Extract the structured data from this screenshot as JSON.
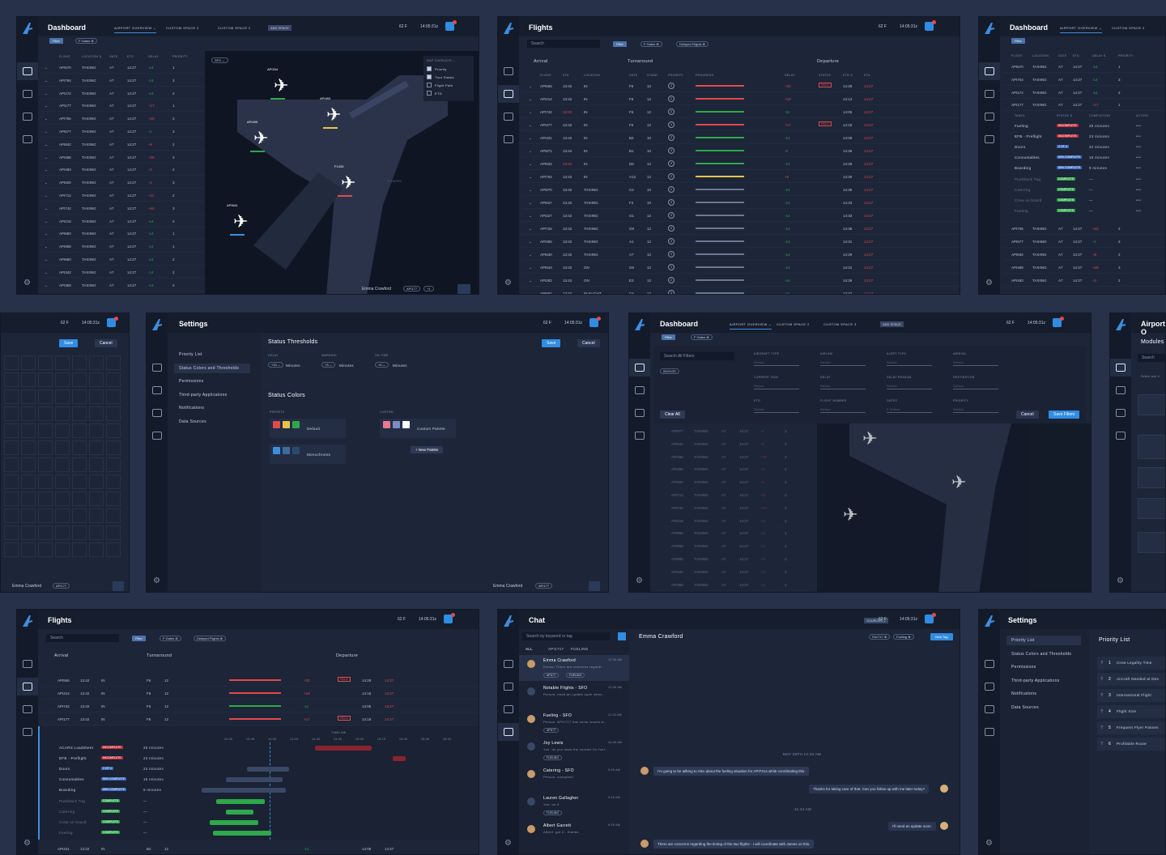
{
  "weather": "62 F",
  "clock": "14:05:31z",
  "user": "Emma Crawford",
  "flight_tag": "API177",
  "flight_tag_count": "+1",
  "colors": {
    "accent": "#3d8ee0",
    "red": "#e24a4a",
    "green": "#2ea84a",
    "yellow": "#e8c34a",
    "panel": "#1d2538"
  },
  "dash1": {
    "title": "Dashboard",
    "tabs": [
      "AIRPORT OVERVIEW ⌄",
      "CUSTOM SPACE 2",
      "CUSTOM SPACE 2"
    ],
    "add_space": "ADD SPACE",
    "filter": "Filter",
    "gates_chip": "F Gates ⊗",
    "cols": [
      "FLIGHT",
      "LOCATION ⇅",
      "GATE",
      "ETD",
      "DELAY",
      "PRIORITY"
    ],
    "rows": [
      [
        "API570",
        "TAXIING",
        "A7",
        "14:27",
        "-14",
        "1"
      ],
      [
        "API794",
        "TAXIING",
        "A7",
        "14:27",
        "-14",
        "3"
      ],
      [
        "API172",
        "TAXIING",
        "A7",
        "14:27",
        "-14",
        "2"
      ],
      [
        "API177",
        "TAXIING",
        "A7",
        "14:27",
        "+17",
        "1"
      ],
      [
        "API756",
        "TAXIING",
        "A7",
        "14:27",
        "+20",
        "2"
      ],
      [
        "API577",
        "TAXIING",
        "A7",
        "14:27",
        "-4",
        "3"
      ],
      [
        "API842",
        "TAXIING",
        "A7",
        "14:27",
        "+5",
        "2"
      ],
      [
        "API468",
        "TAXIING",
        "A7",
        "14:27",
        "+28",
        "3"
      ],
      [
        "API493",
        "TAXIING",
        "A7",
        "14:27",
        "+2",
        "2"
      ],
      [
        "API820",
        "TAXIING",
        "A7",
        "14:27",
        "+1",
        "3"
      ],
      [
        "API712",
        "TAXIING",
        "A7",
        "14:27",
        "+11",
        "2"
      ],
      [
        "API742",
        "TAXIING",
        "A7",
        "14:27",
        "+44",
        "3"
      ],
      [
        "API218",
        "TAXIING",
        "A7",
        "14:27",
        "-14",
        "2"
      ],
      [
        "API850",
        "TAXIING",
        "A7",
        "14:27",
        "-14",
        "1"
      ],
      [
        "API958",
        "TAXIING",
        "A7",
        "14:27",
        "-14",
        "1"
      ],
      [
        "API860",
        "TAXIING",
        "A7",
        "14:27",
        "-14",
        "2"
      ],
      [
        "API342",
        "TAXIING",
        "A7",
        "14:27",
        "-14",
        "2"
      ],
      [
        "API369",
        "TAXIING",
        "A7",
        "14:27",
        "-14",
        "2"
      ]
    ],
    "map_select": "SFO ⌄",
    "overlays_title": "MAP OVERLAYS ⌄",
    "overlays": [
      "Priority",
      "Turn Status",
      "Flight Path",
      "ETD"
    ],
    "planes": [
      "API204",
      "API493",
      "API499",
      "F1433",
      "API844"
    ],
    "gates_label": "F GATES"
  },
  "flights1": {
    "title": "Flights",
    "search": "Search",
    "filter": "Filter",
    "chip1": "F Gates ⊗",
    "chip2": "Delayed Flights ⊗",
    "sections": [
      "Arrival",
      "Turnaround",
      "Departure"
    ],
    "cols": [
      "FLIGHT",
      "ETA",
      "LOCATION",
      "GATE",
      "STAND",
      "PRIORITY",
      "PROGRESS",
      "DELAY",
      "STATUS",
      "ETD ⇅",
      "ETA"
    ],
    "rows": [
      [
        "API565",
        "13:42",
        "IN",
        "F6",
        "12",
        "2",
        "+32",
        "HOLD",
        "14:28",
        "14:27"
      ],
      [
        "API214",
        "13:42",
        "IN",
        "F6",
        "12",
        "2",
        "+19",
        "",
        "14:13",
        "14:27"
      ],
      [
        "API742",
        "13:42",
        "IN",
        "F6",
        "12",
        "2",
        "-11",
        "",
        "14:05",
        "14:27"
      ],
      [
        "API377",
        "13:42",
        "IN",
        "F6",
        "12",
        "1",
        "+17",
        "HOLD",
        "14:18",
        "14:27"
      ],
      [
        "API431",
        "13:42",
        "IN",
        "B2",
        "10",
        "2",
        "-14",
        "",
        "14:08",
        "14:27"
      ],
      [
        "API871",
        "13:42",
        "IN",
        "B1",
        "10",
        "2",
        "-5",
        "",
        "14:36",
        "14:27"
      ],
      [
        "API832",
        "13:42",
        "IN",
        "D6",
        "12",
        "2",
        "-14",
        "",
        "14:29",
        "14:27"
      ],
      [
        "API764",
        "13:42",
        "IN",
        "A13",
        "12",
        "2",
        "+6",
        "",
        "14:30",
        "14:27"
      ],
      [
        "API870",
        "13:42",
        "TAXIING",
        "C2",
        "10",
        "1",
        "-14",
        "",
        "14:38",
        "14:27"
      ],
      [
        "API637",
        "13:42",
        "TAXIING",
        "F3",
        "10",
        "2",
        "-14",
        "",
        "14:43",
        "14:27"
      ],
      [
        "API227",
        "13:42",
        "TAXIING",
        "G1",
        "12",
        "2",
        "-14",
        "",
        "14:33",
        "14:27"
      ],
      [
        "API726",
        "13:42",
        "TAXIING",
        "G9",
        "12",
        "2",
        "-14",
        "",
        "14:36",
        "14:27"
      ],
      [
        "API355",
        "13:42",
        "TAXIING",
        "A1",
        "12",
        "2",
        "-14",
        "",
        "14:31",
        "14:27"
      ],
      [
        "API630",
        "13:42",
        "TAXIING",
        "A7",
        "12",
        "1",
        "-14",
        "",
        "14:29",
        "14:27"
      ],
      [
        "API543",
        "13:42",
        "ON",
        "G6",
        "12",
        "1",
        "-14",
        "",
        "14:31",
        "14:27"
      ],
      [
        "API282",
        "13:42",
        "ON",
        "E3",
        "12",
        "2",
        "-14",
        "",
        "14:39",
        "14:27"
      ],
      [
        "API697",
        "13:42",
        "IN FLIGHT",
        "C6",
        "12",
        "2",
        "-14",
        "",
        "14:42",
        "14:27"
      ]
    ]
  },
  "dash2": {
    "title": "Dashboard",
    "tabs": [
      "AIRPORT OVERVIEW ⌄",
      "CUSTOM SPACE 2"
    ],
    "filter": "Filter",
    "cols": [
      "FLIGHT",
      "LOCATION",
      "GATE",
      "ETD",
      "DELAY ⇅",
      "PRIORITY"
    ],
    "rows_top": [
      [
        "API570",
        "TAXIING",
        "A7",
        "14:27",
        "-14",
        "1"
      ],
      [
        "API704",
        "TAXIING",
        "A7",
        "14:27",
        "-14",
        "3"
      ],
      [
        "API172",
        "TAXIING",
        "A7",
        "14:27",
        "-14",
        "2"
      ],
      [
        "API177",
        "TAXIING",
        "A7",
        "14:27",
        "+17",
        "1"
      ]
    ],
    "task_cols": [
      "TASKS",
      "STATUS ⇅",
      "COMPLETION",
      "ACTION"
    ],
    "tasks": [
      [
        "Fueling",
        "INCOMPLETE",
        "25 minutes"
      ],
      [
        "EFB - Preflight",
        "INCOMPLETE",
        "23 minutes"
      ],
      [
        "Doors",
        "2 OF 4",
        "22 minutes"
      ],
      [
        "Consumables",
        "50% COMPLETE",
        "15 minutes"
      ],
      [
        "Boarding",
        "65% COMPLETE",
        "9 minutes"
      ],
      [
        "Pushback Tug",
        "COMPLETE",
        "—"
      ],
      [
        "Catering",
        "COMPLETE",
        "—"
      ],
      [
        "Crew on board",
        "COMPLETE",
        "—"
      ],
      [
        "Fueling",
        "COMPLETE",
        "—"
      ]
    ],
    "rows_bottom": [
      [
        "API705",
        "TAXIING",
        "A7",
        "14:27",
        "+22",
        "2"
      ],
      [
        "API577",
        "TAXIING",
        "A7",
        "14:27",
        "-4",
        "3"
      ],
      [
        "API842",
        "TAXIING",
        "A7",
        "14:27",
        "+5",
        "2"
      ],
      [
        "API468",
        "TAXIING",
        "A7",
        "14:27",
        "+28",
        "3"
      ],
      [
        "API493",
        "TAXIING",
        "A7",
        "14:27",
        "+2",
        "2"
      ]
    ]
  },
  "edit": {
    "save": "Save",
    "cancel": "Cancel"
  },
  "settings1": {
    "title": "Settings",
    "save": "Save",
    "cancel": "Cancel",
    "menu": [
      "Priority List",
      "Status Colors and Thresholds",
      "Permissions",
      "Third-party Applications",
      "Notifications",
      "Data Sources"
    ],
    "thresholds_title": "Status Thresholds",
    "delay_label": "DELAY",
    "delay_val": "+15 ⌄",
    "warning_label": "WARNING",
    "warning_val": "+3 ⌄",
    "ontime_label": "ON TIME",
    "ontime_val": "+0 ⌄",
    "minutes": "Minutes",
    "colors_title": "Status Colors",
    "presets": "PRESETS",
    "custom": "CUSTOM",
    "default": "Default",
    "mono": "Monochrome",
    "custom_palette": "Custom Palette",
    "new_palette": "+ New Palette"
  },
  "dash3": {
    "title": "Dashboard",
    "tabs": [
      "AIRPORT OVERVIEW ⌄",
      "CUSTOM SPACE 2",
      "CUSTOM SPACE 3"
    ],
    "add_space": "ADD SPACE",
    "filter": "Filter",
    "chip": "F Gates ⊗",
    "search_filters": "Search All Filters",
    "date": "05/21/20",
    "filter_labels": [
      "AIRCRAFT TYPE",
      "AIRLINE",
      "ALERT TYPE",
      "ARRIVAL",
      "CURRENT TASK",
      "DELAY",
      "DELAY REASON",
      "DESTINATION",
      "ETD",
      "FLIGHT NUMBER",
      "GATES",
      "PRIORITY"
    ],
    "select": "Select",
    "gates_val": "F Gates",
    "clear": "Clear All",
    "cancel": "Cancel",
    "save": "Save Filters",
    "rows": [
      [
        "API577",
        "TAXIING",
        "A7",
        "14:27",
        "-4",
        "3"
      ],
      [
        "API842",
        "TAXIING",
        "A7",
        "14:27",
        "+5",
        "2"
      ],
      [
        "API468",
        "TAXIING",
        "A7",
        "14:27",
        "+28",
        "3"
      ],
      [
        "API493",
        "TAXIING",
        "A7",
        "14:27",
        "+2",
        "2"
      ],
      [
        "API820",
        "TAXIING",
        "A7",
        "14:27",
        "+1",
        "3"
      ],
      [
        "API712",
        "TAXIING",
        "A7",
        "14:27",
        "+11",
        "2"
      ],
      [
        "API742",
        "TAXIING",
        "A7",
        "14:27",
        "+44",
        "3"
      ],
      [
        "API218",
        "TAXIING",
        "A7",
        "14:27",
        "-14",
        "2"
      ],
      [
        "API850",
        "TAXIING",
        "A7",
        "14:27",
        "-14",
        "1"
      ],
      [
        "API958",
        "TAXIING",
        "A7",
        "14:27",
        "-14",
        "1"
      ],
      [
        "API860",
        "TAXIING",
        "A7",
        "14:27",
        "-14",
        "2"
      ],
      [
        "API342",
        "TAXIING",
        "A7",
        "14:27",
        "-14",
        "2"
      ],
      [
        "API369",
        "TAXIING",
        "A7",
        "14:27",
        "-14",
        "2"
      ]
    ]
  },
  "airport": {
    "title": "Airport O",
    "modules": "Modules",
    "search": "Search",
    "hint": "Select and d"
  },
  "flights2": {
    "title": "Flights",
    "search": "Search",
    "filter": "Filter",
    "chip1": "F Gates ⊗",
    "chip2": "Delayed Flights ⊗",
    "sections": [
      "Arrival",
      "Turnaround",
      "Departure"
    ],
    "rows": [
      [
        "API565",
        "13:42",
        "IN",
        "F6",
        "12",
        "+32",
        "HOLD",
        "14:28",
        "14:27"
      ],
      [
        "API214",
        "13:42",
        "IN",
        "F6",
        "12",
        "+19",
        "",
        "14:16",
        "14:27"
      ],
      [
        "API742",
        "13:42",
        "IN",
        "F6",
        "12",
        "-11",
        "",
        "14:05",
        "14:27"
      ],
      [
        "API177",
        "13:42",
        "IN",
        "F6",
        "12",
        "+17",
        "HOLD",
        "14:18",
        "14:27"
      ]
    ],
    "times": [
      "13:00",
      "13:45",
      "14:00",
      "14:15",
      "14:30",
      "14:45",
      "15:00",
      "15:15",
      "15:30",
      "15:45",
      "16:00"
    ],
    "tasks": [
      [
        "ACARS Loadsheet",
        "INCOMPLETE",
        "25 minutes"
      ],
      [
        "EFB - Preflight",
        "INCOMPLETE",
        "23 minutes"
      ],
      [
        "Doors",
        "2 OF 4",
        "22 minutes"
      ],
      [
        "Consumables",
        "50% COMPLETE",
        "15 minutes"
      ],
      [
        "Boarding",
        "65% COMPLETE",
        "9 minutes"
      ],
      [
        "Pushback Tug",
        "COMPLETE",
        "—"
      ],
      [
        "Catering",
        "COMPLETE",
        "—"
      ],
      [
        "Crew on board",
        "COMPLETE",
        "—"
      ],
      [
        "Fueling",
        "COMPLETE",
        "—"
      ]
    ],
    "last": [
      "API431",
      "13:42",
      "IN",
      "B2",
      "12",
      "-14",
      "",
      "14:08",
      "14:27"
    ],
    "timeline": "TIMELINE"
  },
  "chat": {
    "title": "Chat",
    "sources": "SOURCES ⌄",
    "search": "Search by keyword or tag",
    "filters": [
      "ALL",
      "API1717",
      "FUELING"
    ],
    "contact": "Emma Crawford",
    "tags": [
      "FA1717 ⊗",
      "Fueling ⊗"
    ],
    "new_tag": "New Tag",
    "threads": [
      {
        "name": "Emma Crawford",
        "time": "12:36 AM",
        "preview": "Emma: There are concerns regardi...",
        "tags": [
          "API177",
          "FUELING"
        ]
      },
      {
        "name": "Notable Flights - SFO",
        "time": "12:06 AM",
        "preview": "Person: need an update soon when...",
        "tags": []
      },
      {
        "name": "Fueling - SFO",
        "time": "11:33 AM",
        "preview": "Person: API1717 has some issues w...",
        "tags": [
          "API177"
        ]
      },
      {
        "name": "Joy Lewis",
        "time": "10:45 AM",
        "preview": "You: do you have the contact for fuel...",
        "tags": [
          "FUELING"
        ]
      },
      {
        "name": "Catering - SFO",
        "time": "9:35 AM",
        "preview": "Person: complete!",
        "tags": []
      },
      {
        "name": "Lauren Gallagher",
        "time": "9:45 AM",
        "preview": "You: on it",
        "tags": [
          "FUELING"
        ]
      },
      {
        "name": "Albert Garrett",
        "time": "9:35 AM",
        "preview": "Albert: got it - thanks",
        "tags": []
      }
    ],
    "date1": "MAY 26TH 10:23 AM",
    "m1": "I'm going to be talking to Alex about the fueling situation for API7414 while coordinating this.",
    "m2": "Thanks for taking care of that. Can you follow up with me later today?",
    "time2": "11:24 AM",
    "m3": "I'll need an update soon.",
    "m4": "There are concerns regarding the timing of the two flights - I will coordinate with James on this."
  },
  "settings2": {
    "title": "Settings",
    "menu": [
      "Priority List",
      "Status Colors and Thresholds",
      "Permissions",
      "Third-party Applications",
      "Notifications",
      "Data Sources"
    ],
    "list_title": "Priority List",
    "items": [
      "Crew Legality Time",
      "Aircraft Needed at Des",
      "International Flight",
      "Flight Size",
      "Frequent Flyer Passen",
      "Profitable Route"
    ]
  }
}
